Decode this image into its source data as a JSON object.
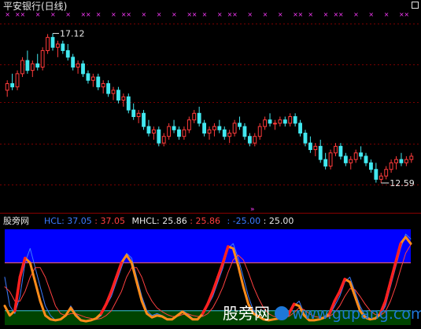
{
  "header": {
    "title": "平安银行(日线)"
  },
  "indicator": {
    "name": "股旁网",
    "hcl_label": "HCL: 37.05",
    "hcl_value": ": 37.05",
    "mhcl_label": "MHCL: 25.86",
    "mhcl_value": ": 25.86",
    "lower_value": ": -25.00",
    "upper_value": ": 25.00"
  },
  "watermark": {
    "text": "股旁网",
    "sub": "www.gupang.com"
  },
  "colors": {
    "up": "#ff3b3b",
    "down": "#42e8f0",
    "hcl": "#3c7cff",
    "mhcl": "#ff4040",
    "band_top": "#0000ff",
    "band_bottom": "#004400",
    "marker": "#ff3cff",
    "k_line": "#ff8c1a",
    "k_line_hot": "#ff2020"
  },
  "chart_data": [
    {
      "type": "candlestick",
      "title": "平安银行(日线)",
      "high_annotation": "17.12",
      "low_annotation": "12.59",
      "price_range": [
        11.9,
        17.8
      ],
      "candles": [
        [
          15.4,
          15.7,
          15.2,
          15.6
        ],
        [
          15.6,
          15.9,
          15.4,
          15.5
        ],
        [
          15.5,
          16.0,
          15.4,
          15.9
        ],
        [
          15.9,
          16.4,
          15.8,
          16.3
        ],
        [
          16.3,
          16.6,
          15.9,
          16.0
        ],
        [
          16.0,
          16.3,
          15.8,
          16.2
        ],
        [
          16.2,
          16.5,
          16.0,
          16.1
        ],
        [
          16.1,
          16.7,
          16.0,
          16.6
        ],
        [
          16.6,
          17.1,
          16.5,
          17.0
        ],
        [
          17.0,
          17.12,
          16.6,
          16.7
        ],
        [
          16.7,
          16.9,
          16.4,
          16.8
        ],
        [
          16.8,
          16.9,
          16.5,
          16.6
        ],
        [
          16.6,
          16.8,
          16.3,
          16.4
        ],
        [
          16.4,
          16.5,
          16.0,
          16.1
        ],
        [
          16.1,
          16.3,
          15.9,
          16.2
        ],
        [
          16.2,
          16.3,
          15.8,
          15.9
        ],
        [
          15.9,
          16.0,
          15.6,
          15.7
        ],
        [
          15.7,
          15.9,
          15.5,
          15.8
        ],
        [
          15.8,
          15.9,
          15.4,
          15.5
        ],
        [
          15.5,
          15.7,
          15.3,
          15.6
        ],
        [
          15.6,
          15.7,
          15.2,
          15.3
        ],
        [
          15.3,
          15.5,
          15.1,
          15.4
        ],
        [
          15.4,
          15.5,
          15.0,
          15.1
        ],
        [
          15.1,
          15.3,
          14.9,
          15.2
        ],
        [
          15.2,
          15.3,
          14.7,
          14.8
        ],
        [
          14.8,
          15.0,
          14.5,
          14.6
        ],
        [
          14.6,
          14.8,
          14.4,
          14.7
        ],
        [
          14.7,
          14.8,
          14.2,
          14.3
        ],
        [
          14.3,
          14.5,
          14.0,
          14.1
        ],
        [
          14.1,
          14.3,
          13.9,
          14.2
        ],
        [
          14.2,
          14.3,
          13.7,
          13.8
        ],
        [
          13.8,
          14.1,
          13.7,
          14.0
        ],
        [
          14.0,
          14.4,
          13.9,
          14.3
        ],
        [
          14.3,
          14.5,
          14.1,
          14.2
        ],
        [
          14.2,
          14.3,
          13.9,
          14.0
        ],
        [
          14.0,
          14.3,
          13.9,
          14.2
        ],
        [
          14.2,
          14.6,
          14.1,
          14.5
        ],
        [
          14.5,
          14.8,
          14.4,
          14.7
        ],
        [
          14.7,
          14.9,
          14.3,
          14.4
        ],
        [
          14.4,
          14.5,
          14.0,
          14.1
        ],
        [
          14.1,
          14.3,
          13.9,
          14.2
        ],
        [
          14.2,
          14.4,
          14.0,
          14.3
        ],
        [
          14.3,
          14.5,
          14.1,
          14.2
        ],
        [
          14.2,
          14.3,
          13.9,
          14.0
        ],
        [
          14.0,
          14.2,
          13.8,
          14.1
        ],
        [
          14.1,
          14.5,
          14.0,
          14.4
        ],
        [
          14.4,
          14.6,
          14.2,
          14.3
        ],
        [
          14.3,
          14.4,
          13.9,
          14.0
        ],
        [
          14.0,
          14.1,
          13.7,
          13.8
        ],
        [
          13.8,
          14.1,
          13.7,
          14.0
        ],
        [
          14.0,
          14.4,
          13.9,
          14.3
        ],
        [
          14.3,
          14.6,
          14.2,
          14.5
        ],
        [
          14.5,
          14.7,
          14.3,
          14.4
        ],
        [
          14.4,
          14.5,
          14.2,
          14.4
        ],
        [
          14.4,
          14.6,
          14.3,
          14.5
        ],
        [
          14.5,
          14.6,
          14.3,
          14.4
        ],
        [
          14.4,
          14.7,
          14.3,
          14.6
        ],
        [
          14.6,
          14.7,
          14.3,
          14.4
        ],
        [
          14.4,
          14.5,
          14.0,
          14.1
        ],
        [
          14.1,
          14.2,
          13.7,
          13.8
        ],
        [
          13.8,
          14.0,
          13.5,
          13.6
        ],
        [
          13.6,
          13.8,
          13.4,
          13.7
        ],
        [
          13.7,
          13.9,
          13.2,
          13.3
        ],
        [
          13.3,
          13.5,
          13.0,
          13.1
        ],
        [
          13.1,
          13.6,
          13.0,
          13.5
        ],
        [
          13.5,
          13.8,
          13.4,
          13.7
        ],
        [
          13.7,
          13.8,
          13.3,
          13.4
        ],
        [
          13.4,
          13.5,
          13.1,
          13.2
        ],
        [
          13.2,
          13.4,
          13.0,
          13.3
        ],
        [
          13.3,
          13.6,
          13.2,
          13.5
        ],
        [
          13.5,
          13.7,
          13.3,
          13.4
        ],
        [
          13.4,
          13.5,
          13.1,
          13.2
        ],
        [
          13.2,
          13.3,
          12.9,
          13.0
        ],
        [
          13.0,
          13.2,
          12.6,
          12.7
        ],
        [
          12.7,
          12.9,
          12.59,
          12.8
        ],
        [
          12.8,
          13.1,
          12.7,
          13.0
        ],
        [
          13.0,
          13.3,
          12.9,
          13.2
        ],
        [
          13.2,
          13.4,
          13.0,
          13.3
        ],
        [
          13.3,
          13.5,
          13.1,
          13.2
        ],
        [
          13.2,
          13.4,
          13.1,
          13.3
        ],
        [
          13.3,
          13.5,
          13.2,
          13.4
        ]
      ],
      "marker_rows": "x-markers above price pane",
      "note": "candle arrays are [open, high, low, close]"
    },
    {
      "type": "line",
      "title": "股旁网",
      "ylim": [
        -40,
        60
      ],
      "band_upper": 25.0,
      "band_lower": -25.0,
      "series": [
        {
          "name": "HCL",
          "values": [
            10,
            -20,
            -28,
            -10,
            25,
            40,
            20,
            0,
            -20,
            -30,
            -35,
            -34,
            -30,
            -20,
            -28,
            -34,
            -36,
            -35,
            -34,
            -30,
            -20,
            -10,
            5,
            20,
            35,
            30,
            10,
            -10,
            -25,
            -30,
            -28,
            -30,
            -33,
            -34,
            -30,
            -25,
            -28,
            -33,
            -34,
            -30,
            -20,
            -10,
            5,
            20,
            40,
            45,
            30,
            10,
            -10,
            -25,
            -30,
            -33,
            -35,
            -34,
            -33,
            -32,
            -30,
            -20,
            -15,
            -28,
            -34,
            -35,
            -34,
            -33,
            -30,
            -20,
            -10,
            5,
            10,
            -5,
            -20,
            -30,
            -33,
            -34,
            -30,
            -20,
            0,
            20,
            40,
            55,
            50
          ]
        },
        {
          "name": "MHCL",
          "values": [
            0,
            -5,
            -15,
            -15,
            -5,
            10,
            20,
            20,
            10,
            -5,
            -20,
            -28,
            -30,
            -28,
            -28,
            -30,
            -32,
            -33,
            -34,
            -33,
            -30,
            -25,
            -15,
            -5,
            10,
            20,
            20,
            10,
            -5,
            -15,
            -22,
            -26,
            -29,
            -31,
            -31,
            -29,
            -28,
            -30,
            -31,
            -31,
            -28,
            -22,
            -12,
            0,
            15,
            28,
            33,
            28,
            15,
            0,
            -12,
            -22,
            -28,
            -31,
            -32,
            -32,
            -31,
            -27,
            -22,
            -24,
            -28,
            -31,
            -32,
            -32,
            -31,
            -27,
            -20,
            -10,
            -2,
            -3,
            -10,
            -18,
            -25,
            -29,
            -30,
            -26,
            -15,
            0,
            18,
            35,
            44
          ]
        },
        {
          "name": "K",
          "values": [
            -20,
            -30,
            -25,
            10,
            30,
            25,
            5,
            -15,
            -30,
            -34,
            -35,
            -34,
            -30,
            -22,
            -30,
            -35,
            -36,
            -35,
            -33,
            -28,
            -18,
            -5,
            10,
            25,
            33,
            25,
            5,
            -15,
            -28,
            -32,
            -30,
            -31,
            -34,
            -34,
            -30,
            -26,
            -30,
            -34,
            -34,
            -28,
            -18,
            -5,
            10,
            25,
            42,
            40,
            22,
            0,
            -18,
            -28,
            -31,
            -34,
            -35,
            -34,
            -33,
            -32,
            -28,
            -18,
            -20,
            -30,
            -35,
            -35,
            -34,
            -32,
            -28,
            -15,
            -5,
            8,
            5,
            -10,
            -25,
            -32,
            -34,
            -33,
            -28,
            -15,
            5,
            25,
            45,
            52,
            45
          ]
        }
      ]
    }
  ]
}
